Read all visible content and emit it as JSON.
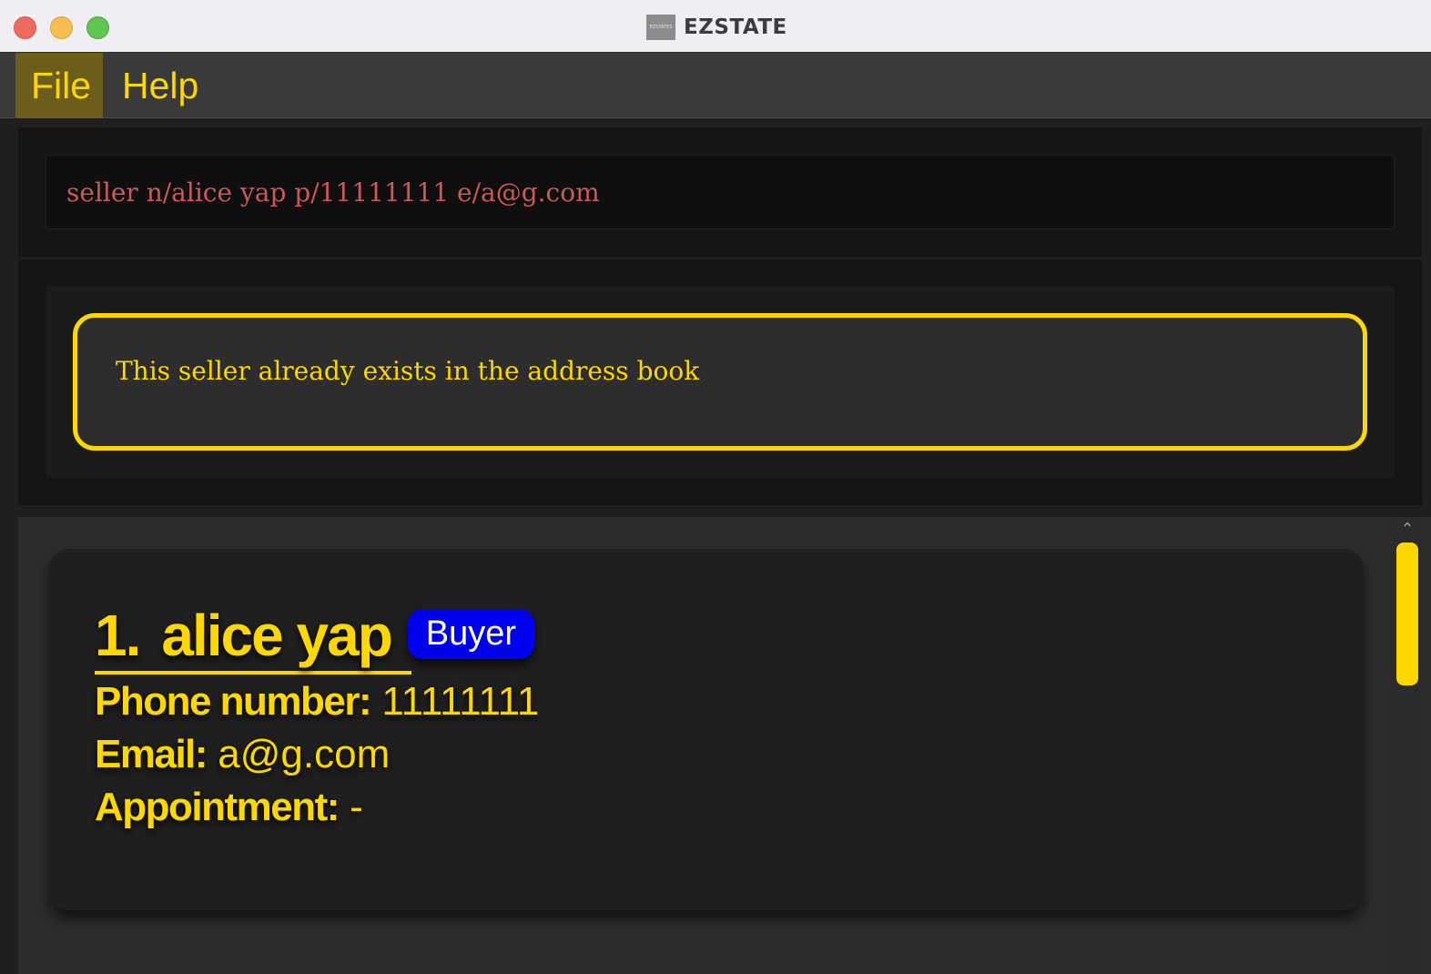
{
  "window": {
    "title": "EZSTATE",
    "icon_text": "EZSTATES",
    "icon": "app-logo-icon"
  },
  "menu": {
    "items": [
      {
        "label": "File",
        "selected": true
      },
      {
        "label": "Help",
        "selected": false
      }
    ]
  },
  "command": {
    "value": "seller n/alice yap p/11111111 e/a@g.com"
  },
  "result": {
    "message": "This seller already exists in the address book"
  },
  "persons": [
    {
      "index": "1.",
      "name": "alice yap",
      "tag": "Buyer",
      "phone_label": "Phone number:",
      "phone": "11111111",
      "email_label": "Email:",
      "email": "a@g.com",
      "appointment_label": "Appointment:",
      "appointment": "-"
    }
  ],
  "colors": {
    "accent": "#ffd700",
    "error_text": "#c9595a",
    "tag_bg": "#0000ee",
    "background": "#1f1f1f"
  }
}
